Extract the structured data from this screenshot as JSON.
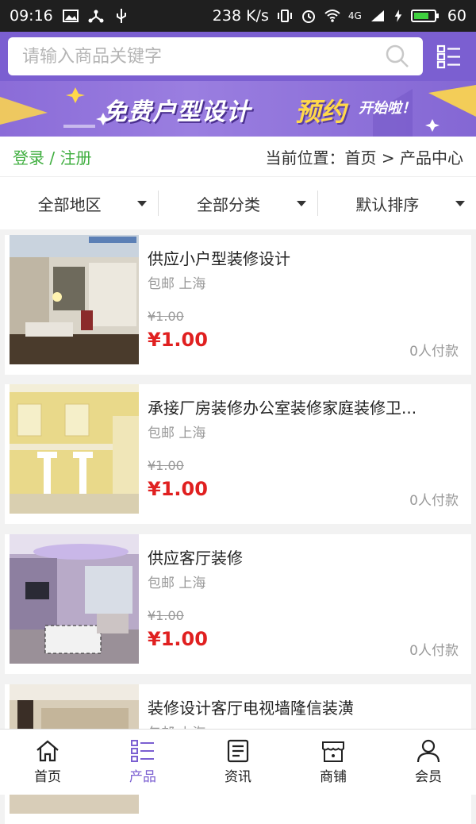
{
  "status_bar": {
    "time": "09:16",
    "speed": "238 K/s",
    "network": "4G",
    "battery": "60"
  },
  "search": {
    "placeholder": "请输入商品关键字"
  },
  "banner": {
    "text_main": "免费户型设计",
    "text_highlight": "预约",
    "text_small": "开始啦！"
  },
  "breadcrumb": {
    "login": "登录 / 注册",
    "location": "当前位置：首页 > 产品中心"
  },
  "filters": [
    {
      "label": "全部地区"
    },
    {
      "label": "全部分类"
    },
    {
      "label": "默认排序"
    }
  ],
  "products": [
    {
      "title": "供应小户型装修设计",
      "sub": "包邮 上海",
      "old_price": "¥1.00",
      "price": "¥1.00",
      "sold": "0人付款"
    },
    {
      "title": "承接厂房装修办公室装修家庭装修卫...",
      "sub": "包邮 上海",
      "old_price": "¥1.00",
      "price": "¥1.00",
      "sold": "0人付款"
    },
    {
      "title": "供应客厅装修",
      "sub": "包邮 上海",
      "old_price": "¥1.00",
      "price": "¥1.00",
      "sold": "0人付款"
    },
    {
      "title": "装修设计客厅电视墙隆信装潢",
      "sub": "包邮 上海",
      "old_price": "",
      "price": "",
      "sold": ""
    }
  ],
  "bottom_nav": [
    {
      "label": "首页",
      "icon": "home-icon"
    },
    {
      "label": "产品",
      "icon": "list-icon",
      "active": true
    },
    {
      "label": "资讯",
      "icon": "news-icon"
    },
    {
      "label": "商铺",
      "icon": "store-icon"
    },
    {
      "label": "会员",
      "icon": "user-icon"
    }
  ],
  "colors": {
    "brand": "#7b5fd1",
    "price": "#e02020",
    "login": "#3fae3f"
  }
}
